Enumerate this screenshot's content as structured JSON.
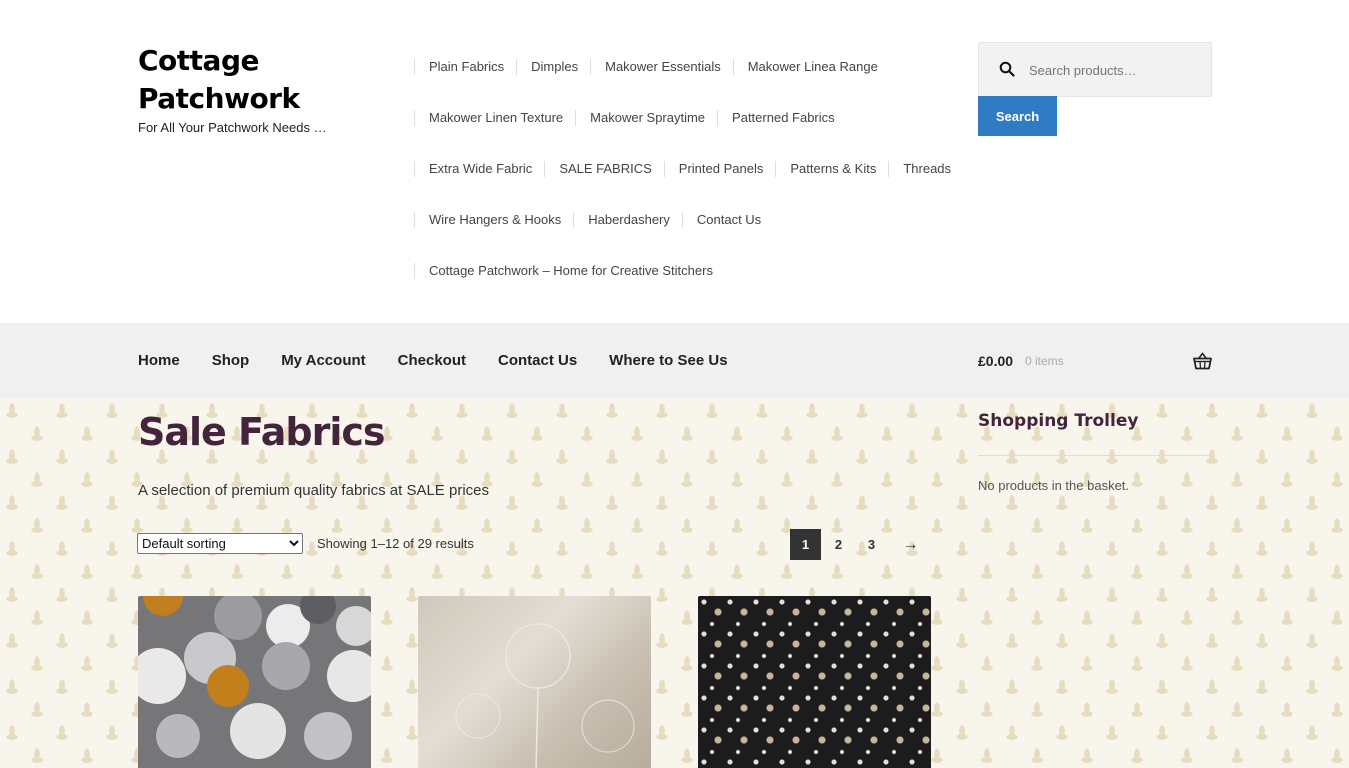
{
  "site": {
    "title": "Cottage Patchwork",
    "tagline": "For All Your Patchwork Needs …"
  },
  "secondary_nav": {
    "rows": [
      [
        "Plain Fabrics",
        "Dimples",
        "Makower Essentials",
        "Makower Linea Range"
      ],
      [
        "Makower Linen Texture",
        "Makower Spraytime",
        "Patterned Fabrics"
      ],
      [
        "Extra Wide Fabric",
        "SALE FABRICS",
        "Printed Panels",
        "Patterns & Kits",
        "Threads"
      ],
      [
        "Wire Hangers & Hooks",
        "Haberdashery",
        "Contact Us"
      ],
      [
        "Cottage Patchwork – Home for Creative Stitchers"
      ]
    ]
  },
  "search": {
    "placeholder": "Search products…",
    "button_label": "Search",
    "icon": "search-icon"
  },
  "primary_nav": {
    "items": [
      "Home",
      "Shop",
      "My Account",
      "Checkout",
      "Contact Us",
      "Where to See Us"
    ]
  },
  "cart": {
    "total": "£0.00",
    "count": "0 items",
    "icon": "basket-icon"
  },
  "page": {
    "title": "Sale Fabrics",
    "description": "A selection of premium quality fabrics at SALE prices",
    "sort_selected": "Default sorting",
    "result_count": "Showing 1–12 of 29 results"
  },
  "pagination": {
    "pages": [
      "1",
      "2",
      "3"
    ],
    "current": "1",
    "next": "→"
  },
  "sidebar": {
    "title": "Shopping Trolley",
    "empty_message": "No products in the basket."
  },
  "colors": {
    "accent": "#2f7bc4",
    "heading": "#43243a",
    "nav_bar": "#f0f0f0",
    "content_bg": "#f8f5ec"
  }
}
